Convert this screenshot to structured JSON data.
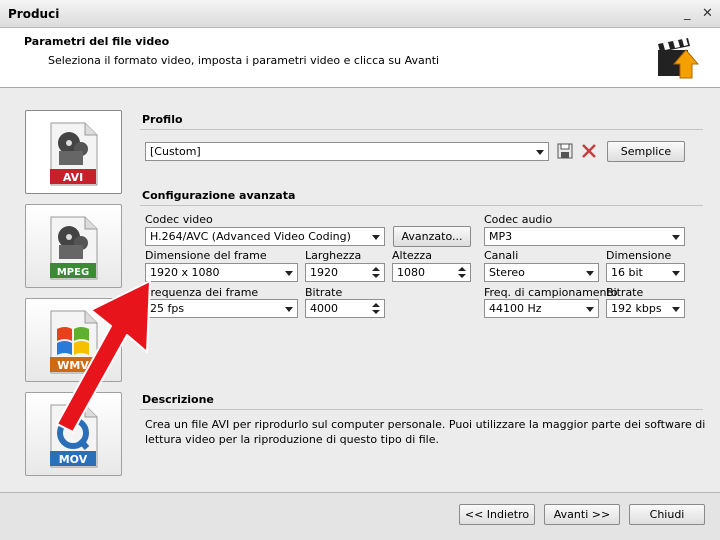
{
  "window": {
    "title": "Produci"
  },
  "header": {
    "title": "Parametri del file video",
    "subtitle": "Seleziona il formato video, imposta i parametri video e clicca su Avanti"
  },
  "formats": [
    {
      "label": "AVI",
      "color": "#c8202a"
    },
    {
      "label": "MPEG",
      "color": "#3c8a36"
    },
    {
      "label": "WMV",
      "color": "#d06a10"
    },
    {
      "label": "MOV",
      "color": "#2a6fb8"
    }
  ],
  "profile": {
    "section_title": "Profilo",
    "value": "[Custom]",
    "simple_button": "Semplice"
  },
  "advanced": {
    "section_title": "Configurazione avanzata",
    "video_codec_label": "Codec video",
    "video_codec_value": "H.264/AVC (Advanced Video Coding)",
    "advanced_button": "Avanzato...",
    "audio_codec_label": "Codec audio",
    "audio_codec_value": "MP3",
    "frame_size_label": "Dimensione del frame",
    "frame_size_value": "1920 x 1080",
    "width_label": "Larghezza",
    "width_value": "1920",
    "height_label": "Altezza",
    "height_value": "1080",
    "channels_label": "Canali",
    "channels_value": "Stereo",
    "sample_size_label": "Dimensione",
    "sample_size_value": "16 bit",
    "frame_rate_label": "Frequenza dei frame",
    "frame_rate_value": "25 fps",
    "video_bitrate_label": "Bitrate",
    "video_bitrate_value": "4000",
    "sample_rate_label": "Freq. di campionamento",
    "sample_rate_value": "44100 Hz",
    "audio_bitrate_label": "Bitrate",
    "audio_bitrate_value": "192 kbps"
  },
  "description": {
    "section_title": "Descrizione",
    "text": "Crea un file AVI per riprodurlo sul computer personale. Puoi utilizzare la maggior parte dei software di lettura video per la riproduzione di questo tipo di file."
  },
  "footer": {
    "back_button": "<< Indietro",
    "next_button": "Avanti >>",
    "close_button": "Chiudi"
  },
  "colors": {
    "annotation_arrow": "#e8141c",
    "accent_orange": "#f4a000"
  }
}
